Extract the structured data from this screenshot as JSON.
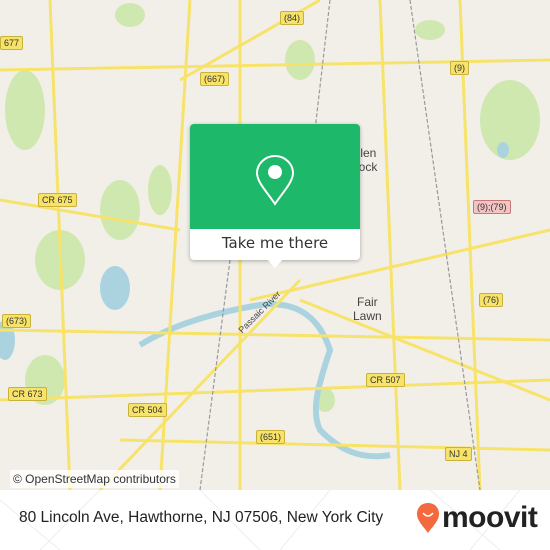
{
  "map": {
    "labels": {
      "r677": "677",
      "r667": "(667)",
      "r84": "(84)",
      "r9": "(9)",
      "cr675": "CR 675",
      "r9_79": "(9);(79)",
      "r76": "(76)",
      "r673": "(673)",
      "cr673": "CR 673",
      "cr504": "CR 504",
      "cr507": "CR 507",
      "r651": "(651)",
      "nj4": "NJ 4",
      "fair_lawn": "Fair\nLawn",
      "glen_rock": "Glen\nRock",
      "passaic_river": "Passaic River"
    },
    "colors": {
      "land": "#f2efe9",
      "park": "#cfe8b0",
      "water": "#aad3df",
      "road": "#f7e36a"
    }
  },
  "popup": {
    "button_label": "Take me there",
    "color": "#1eb86a",
    "icon": "map-pin-icon"
  },
  "attribution": "© OpenStreetMap contributors",
  "footer": {
    "address": "80 Lincoln Ave, Hawthorne, NJ 07506, New York City",
    "brand": "moovit",
    "brand_color": "#f26a3d"
  }
}
